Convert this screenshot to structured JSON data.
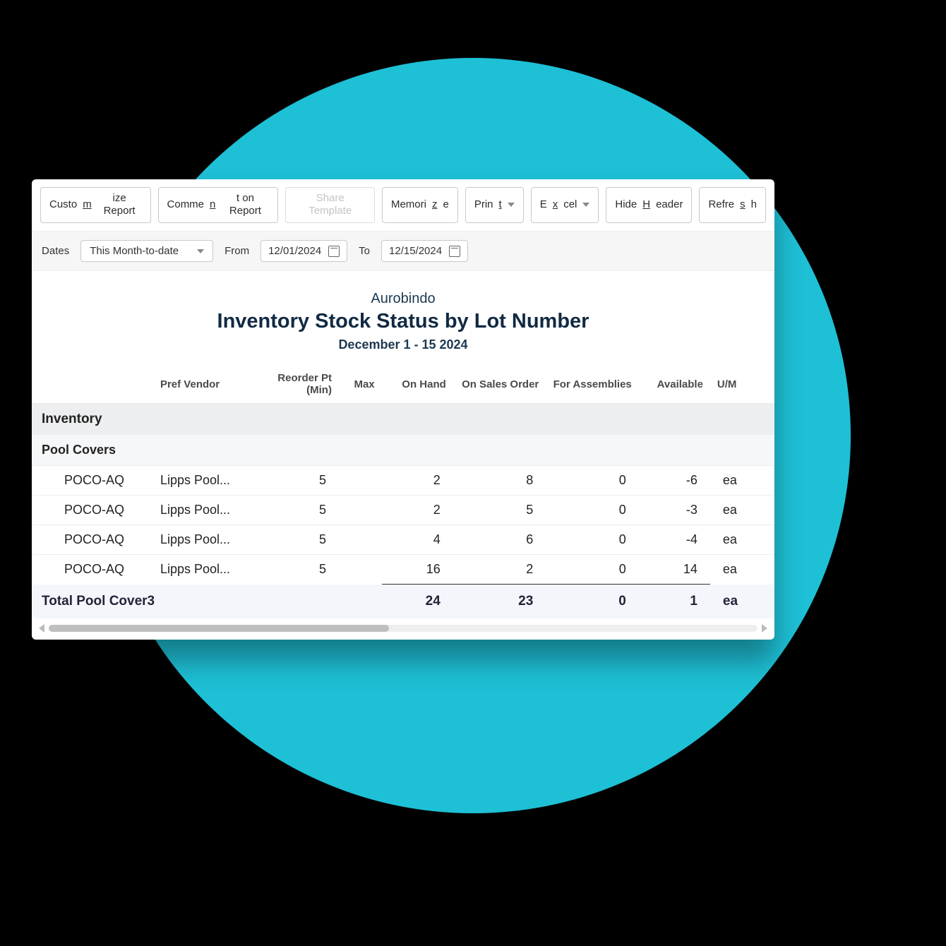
{
  "toolbar": {
    "customize": "Customize Report",
    "comment": "Comment on Report",
    "share": "Share Template",
    "memorize": "Memorize",
    "print": "Print",
    "excel": "Excel",
    "hide_header": "Hide Header",
    "refresh": "Refresh"
  },
  "filters": {
    "dates_label": "Dates",
    "preset": "This Month-to-date",
    "from_label": "From",
    "from": "12/01/2024",
    "to_label": "To",
    "to": "12/15/2024"
  },
  "report": {
    "company": "Aurobindo",
    "title": "Inventory Stock Status by Lot Number",
    "period": "December 1 - 15 2024"
  },
  "columns": {
    "pref_vendor": "Pref Vendor",
    "reorder": "Reorder Pt (Min)",
    "max": "Max",
    "on_hand": "On Hand",
    "on_sales": "On Sales Order",
    "for_asm": "For Assemblies",
    "available": "Available",
    "uom": "U/M"
  },
  "sections": {
    "inventory": "Inventory",
    "group": "Pool Covers"
  },
  "rows": [
    {
      "code": "POCO-AQ",
      "vendor": "Lipps Pool...",
      "reorder": "5",
      "max": "",
      "on_hand": "2",
      "on_sales": "8",
      "for_asm": "0",
      "available": "-6",
      "uom": "ea"
    },
    {
      "code": "POCO-AQ",
      "vendor": "Lipps Pool...",
      "reorder": "5",
      "max": "",
      "on_hand": "2",
      "on_sales": "5",
      "for_asm": "0",
      "available": "-3",
      "uom": "ea"
    },
    {
      "code": "POCO-AQ",
      "vendor": "Lipps Pool...",
      "reorder": "5",
      "max": "",
      "on_hand": "4",
      "on_sales": "6",
      "for_asm": "0",
      "available": "-4",
      "uom": "ea"
    },
    {
      "code": "POCO-AQ",
      "vendor": "Lipps Pool...",
      "reorder": "5",
      "max": "",
      "on_hand": "16",
      "on_sales": "2",
      "for_asm": "0",
      "available": "14",
      "uom": "ea"
    }
  ],
  "total": {
    "label": "Total Pool Cover3",
    "on_hand": "24",
    "on_sales": "23",
    "for_asm": "0",
    "available": "1",
    "uom": "ea"
  }
}
